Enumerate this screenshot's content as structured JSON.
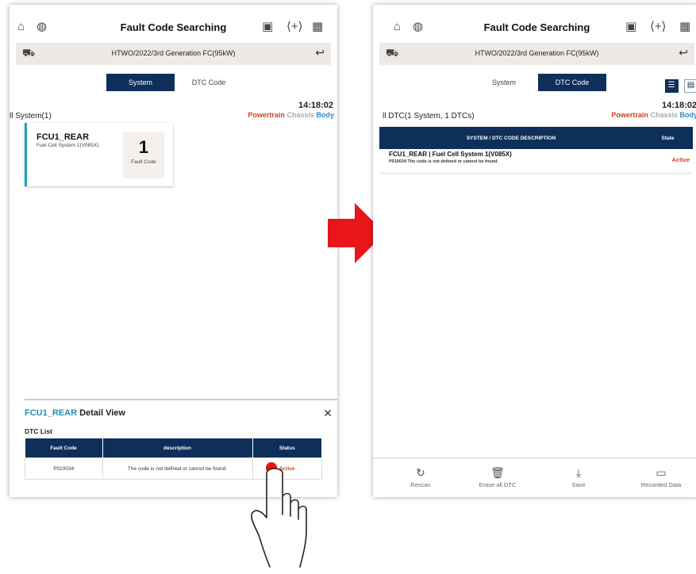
{
  "header": {
    "title": "Fault Code Searching"
  },
  "vehicle": {
    "name": "HTWO/2022/3rd Generation FC(95kW)"
  },
  "tabs": {
    "system": "System",
    "dtc": "DTC Code"
  },
  "time": "14:18:02",
  "filters": {
    "powertrain": "Powertrain",
    "chassis": "Chassis",
    "body": "Body"
  },
  "left": {
    "summary": "ll System(1)",
    "card": {
      "name": "FCU1_REAR",
      "desc": "Fuel Cell System 1(V085X)",
      "count": "1",
      "count_label": "Fault Code"
    },
    "detail": {
      "title_accent": "FCU1_REAR",
      "title_rest": "Detail View",
      "list_label": "DTC List",
      "columns": [
        "Fault Code",
        "description",
        "Status"
      ],
      "row": {
        "code": "P010034",
        "desc": "The code is not defined or cannot be found.",
        "status": "Active"
      }
    }
  },
  "right": {
    "summary": "ll DTC(1 System, 1 DTCs)",
    "columns": [
      "SYSTEM / DTC CODE DESCRIPTION",
      "State"
    ],
    "row": {
      "name": "FCU1_REAR | Fuel Cell System 1(V085X)",
      "desc": "P010034 The code is not defined or cannot be found.",
      "state": "Active"
    },
    "bottom": [
      "Rescan",
      "Erase all DTC",
      "Save",
      "Recorded Data"
    ]
  },
  "colors": {
    "navy": "#0e2f5a",
    "red": "#d4401f",
    "blue": "#2f86c8",
    "arrow": "#e8161a"
  },
  "icons": [
    "home-icon",
    "globe-settings-icon",
    "vci-icon",
    "expand-icon",
    "grid-icon",
    "vehicle-icon",
    "back-icon"
  ]
}
